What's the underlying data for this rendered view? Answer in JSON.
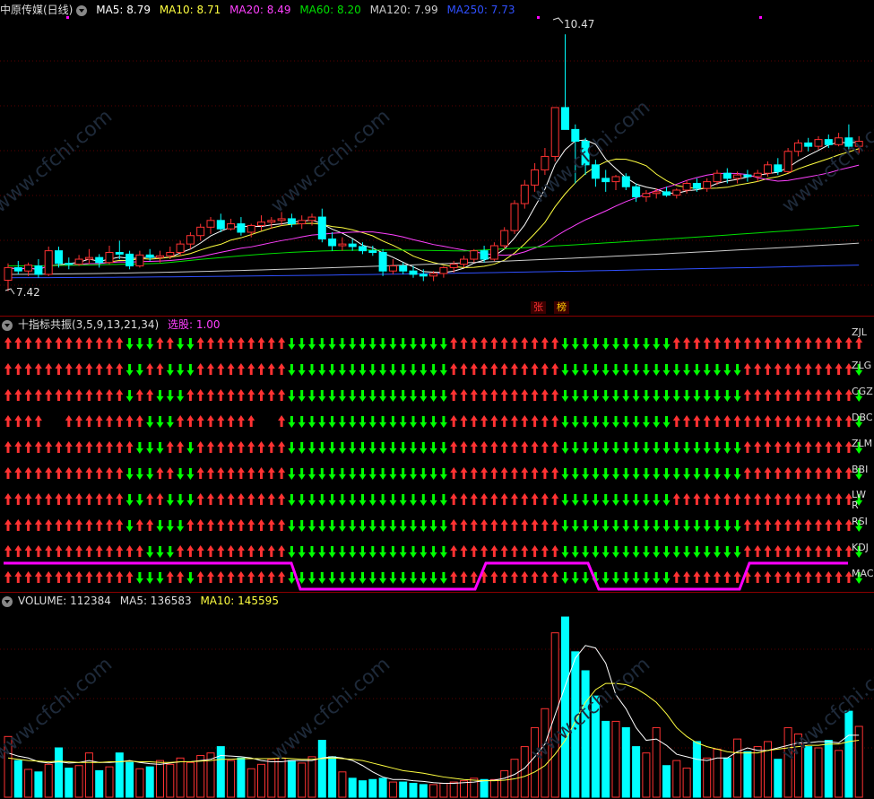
{
  "main": {
    "title": "中原传媒(日线)",
    "ma": [
      {
        "label": "MA5: 8.79",
        "color": "#ffffff"
      },
      {
        "label": "MA10: 8.71",
        "color": "#ffff40"
      },
      {
        "label": "MA20: 8.49",
        "color": "#ff40ff"
      },
      {
        "label": "MA60: 8.20",
        "color": "#00e000"
      },
      {
        "label": "MA120: 7.99",
        "color": "#cccccc"
      },
      {
        "label": "MA250: 7.73",
        "color": "#3050ff"
      }
    ],
    "high_label": "10.47",
    "low_label": "7.42",
    "tags": [
      "张",
      "榜"
    ]
  },
  "indicator": {
    "title": "十指标共振(3,5,9,13,21,34)",
    "pick_label": "选股: 1.00",
    "rows": [
      "ZJL",
      "ZLGJ",
      "CGZ",
      "DBC",
      "ZLMM",
      "BBI",
      "LWR",
      "RSI",
      "KDJ",
      "MACD"
    ],
    "row_labels": [
      "ZJL",
      "ZLG",
      "CGZ",
      "DBC",
      "ZLM",
      "BBI",
      "LW R",
      "RSI",
      "KDJ",
      "MAC"
    ]
  },
  "volume": {
    "title": "VOLUME: 112384",
    "ma5": "MA5: 136583",
    "ma10": "MA10: 145595"
  },
  "watermark": "www.cfchi.com",
  "colors": {
    "up": "#ff3232",
    "down": "#00ff00",
    "cyan": "#00ffff",
    "magenta": "#ff00ff",
    "grid": "#8b0000"
  },
  "chart_data": {
    "type": "candlestick",
    "title": "中原传媒(日线)",
    "price_extremes": {
      "high": 10.47,
      "low": 7.42
    },
    "candles": [
      {
        "o": 7.55,
        "h": 7.75,
        "l": 7.42,
        "c": 7.7
      },
      {
        "o": 7.7,
        "h": 7.78,
        "l": 7.62,
        "c": 7.66
      },
      {
        "o": 7.66,
        "h": 7.76,
        "l": 7.6,
        "c": 7.73
      },
      {
        "o": 7.72,
        "h": 7.8,
        "l": 7.58,
        "c": 7.62
      },
      {
        "o": 7.62,
        "h": 7.95,
        "l": 7.6,
        "c": 7.9
      },
      {
        "o": 7.9,
        "h": 7.95,
        "l": 7.7,
        "c": 7.75
      },
      {
        "o": 7.75,
        "h": 7.82,
        "l": 7.68,
        "c": 7.74
      },
      {
        "o": 7.74,
        "h": 7.85,
        "l": 7.72,
        "c": 7.8
      },
      {
        "o": 7.8,
        "h": 7.92,
        "l": 7.74,
        "c": 7.82
      },
      {
        "o": 7.82,
        "h": 7.86,
        "l": 7.7,
        "c": 7.76
      },
      {
        "o": 7.76,
        "h": 7.96,
        "l": 7.74,
        "c": 7.88
      },
      {
        "o": 7.88,
        "h": 8.02,
        "l": 7.8,
        "c": 7.86
      },
      {
        "o": 7.86,
        "h": 7.9,
        "l": 7.68,
        "c": 7.72
      },
      {
        "o": 7.72,
        "h": 7.9,
        "l": 7.7,
        "c": 7.85
      },
      {
        "o": 7.85,
        "h": 7.92,
        "l": 7.78,
        "c": 7.82
      },
      {
        "o": 7.82,
        "h": 7.9,
        "l": 7.76,
        "c": 7.84
      },
      {
        "o": 7.84,
        "h": 7.95,
        "l": 7.8,
        "c": 7.88
      },
      {
        "o": 7.88,
        "h": 8.02,
        "l": 7.84,
        "c": 7.98
      },
      {
        "o": 7.98,
        "h": 8.12,
        "l": 7.92,
        "c": 8.08
      },
      {
        "o": 8.08,
        "h": 8.22,
        "l": 8.02,
        "c": 8.18
      },
      {
        "o": 8.18,
        "h": 8.3,
        "l": 8.1,
        "c": 8.26
      },
      {
        "o": 8.26,
        "h": 8.34,
        "l": 8.12,
        "c": 8.16
      },
      {
        "o": 8.16,
        "h": 8.28,
        "l": 8.14,
        "c": 8.22
      },
      {
        "o": 8.22,
        "h": 8.3,
        "l": 8.08,
        "c": 8.12
      },
      {
        "o": 8.12,
        "h": 8.22,
        "l": 8.06,
        "c": 8.2
      },
      {
        "o": 8.2,
        "h": 8.32,
        "l": 8.14,
        "c": 8.24
      },
      {
        "o": 8.24,
        "h": 8.3,
        "l": 8.16,
        "c": 8.26
      },
      {
        "o": 8.26,
        "h": 8.36,
        "l": 8.2,
        "c": 8.28
      },
      {
        "o": 8.28,
        "h": 8.34,
        "l": 8.18,
        "c": 8.22
      },
      {
        "o": 8.22,
        "h": 8.32,
        "l": 8.16,
        "c": 8.26
      },
      {
        "o": 8.26,
        "h": 8.34,
        "l": 8.2,
        "c": 8.3
      },
      {
        "o": 8.3,
        "h": 8.4,
        "l": 8.0,
        "c": 8.04
      },
      {
        "o": 8.04,
        "h": 8.12,
        "l": 7.9,
        "c": 7.96
      },
      {
        "o": 7.96,
        "h": 8.06,
        "l": 7.9,
        "c": 7.98
      },
      {
        "o": 7.98,
        "h": 8.04,
        "l": 7.9,
        "c": 7.95
      },
      {
        "o": 7.95,
        "h": 8.0,
        "l": 7.86,
        "c": 7.9
      },
      {
        "o": 7.9,
        "h": 7.96,
        "l": 7.84,
        "c": 7.88
      },
      {
        "o": 7.88,
        "h": 7.92,
        "l": 7.6,
        "c": 7.66
      },
      {
        "o": 7.66,
        "h": 7.8,
        "l": 7.62,
        "c": 7.72
      },
      {
        "o": 7.72,
        "h": 7.76,
        "l": 7.62,
        "c": 7.66
      },
      {
        "o": 7.66,
        "h": 7.72,
        "l": 7.58,
        "c": 7.62
      },
      {
        "o": 7.62,
        "h": 7.68,
        "l": 7.54,
        "c": 7.6
      },
      {
        "o": 7.6,
        "h": 7.66,
        "l": 7.54,
        "c": 7.63
      },
      {
        "o": 7.63,
        "h": 7.72,
        "l": 7.58,
        "c": 7.7
      },
      {
        "o": 7.7,
        "h": 7.78,
        "l": 7.64,
        "c": 7.74
      },
      {
        "o": 7.74,
        "h": 7.84,
        "l": 7.7,
        "c": 7.8
      },
      {
        "o": 7.8,
        "h": 7.92,
        "l": 7.76,
        "c": 7.9
      },
      {
        "o": 7.9,
        "h": 7.96,
        "l": 7.76,
        "c": 7.8
      },
      {
        "o": 7.8,
        "h": 8.0,
        "l": 7.78,
        "c": 7.96
      },
      {
        "o": 7.96,
        "h": 8.18,
        "l": 7.92,
        "c": 8.14
      },
      {
        "o": 8.14,
        "h": 8.5,
        "l": 8.1,
        "c": 8.46
      },
      {
        "o": 8.46,
        "h": 8.74,
        "l": 8.4,
        "c": 8.68
      },
      {
        "o": 8.68,
        "h": 8.94,
        "l": 8.6,
        "c": 8.86
      },
      {
        "o": 8.86,
        "h": 9.12,
        "l": 8.8,
        "c": 9.02
      },
      {
        "o": 9.02,
        "h": 9.3,
        "l": 8.96,
        "c": 9.6
      },
      {
        "o": 9.6,
        "h": 10.47,
        "l": 9.5,
        "c": 9.34
      },
      {
        "o": 9.34,
        "h": 9.4,
        "l": 8.7,
        "c": 9.2
      },
      {
        "o": 9.2,
        "h": 9.24,
        "l": 8.8,
        "c": 8.92
      },
      {
        "o": 8.92,
        "h": 8.98,
        "l": 8.66,
        "c": 8.76
      },
      {
        "o": 8.76,
        "h": 8.86,
        "l": 8.6,
        "c": 8.72
      },
      {
        "o": 8.72,
        "h": 8.8,
        "l": 8.62,
        "c": 8.78
      },
      {
        "o": 8.78,
        "h": 8.82,
        "l": 8.62,
        "c": 8.66
      },
      {
        "o": 8.66,
        "h": 8.7,
        "l": 8.48,
        "c": 8.54
      },
      {
        "o": 8.54,
        "h": 8.62,
        "l": 8.48,
        "c": 8.58
      },
      {
        "o": 8.58,
        "h": 8.64,
        "l": 8.52,
        "c": 8.6
      },
      {
        "o": 8.6,
        "h": 8.66,
        "l": 8.54,
        "c": 8.56
      },
      {
        "o": 8.56,
        "h": 8.64,
        "l": 8.52,
        "c": 8.62
      },
      {
        "o": 8.62,
        "h": 8.74,
        "l": 8.58,
        "c": 8.7
      },
      {
        "o": 8.7,
        "h": 8.76,
        "l": 8.6,
        "c": 8.64
      },
      {
        "o": 8.64,
        "h": 8.76,
        "l": 8.6,
        "c": 8.72
      },
      {
        "o": 8.72,
        "h": 8.86,
        "l": 8.68,
        "c": 8.82
      },
      {
        "o": 8.82,
        "h": 8.88,
        "l": 8.7,
        "c": 8.76
      },
      {
        "o": 8.76,
        "h": 8.84,
        "l": 8.7,
        "c": 8.8
      },
      {
        "o": 8.8,
        "h": 8.86,
        "l": 8.72,
        "c": 8.78
      },
      {
        "o": 8.78,
        "h": 8.86,
        "l": 8.72,
        "c": 8.82
      },
      {
        "o": 8.82,
        "h": 8.96,
        "l": 8.78,
        "c": 8.92
      },
      {
        "o": 8.92,
        "h": 9.0,
        "l": 8.8,
        "c": 8.84
      },
      {
        "o": 8.84,
        "h": 9.12,
        "l": 8.82,
        "c": 9.08
      },
      {
        "o": 9.08,
        "h": 9.22,
        "l": 9.02,
        "c": 9.18
      },
      {
        "o": 9.18,
        "h": 9.24,
        "l": 9.08,
        "c": 9.14
      },
      {
        "o": 9.14,
        "h": 9.26,
        "l": 9.1,
        "c": 9.22
      },
      {
        "o": 9.22,
        "h": 9.28,
        "l": 9.12,
        "c": 9.16
      },
      {
        "o": 9.16,
        "h": 9.3,
        "l": 9.14,
        "c": 9.24
      },
      {
        "o": 9.24,
        "h": 9.4,
        "l": 9.1,
        "c": 9.14
      },
      {
        "o": 9.14,
        "h": 9.26,
        "l": 9.06,
        "c": 9.2
      }
    ],
    "volume": [
      96,
      58,
      44,
      40,
      52,
      78,
      46,
      50,
      70,
      42,
      48,
      70,
      55,
      45,
      48,
      58,
      52,
      62,
      55,
      66,
      70,
      80,
      58,
      62,
      45,
      52,
      60,
      62,
      58,
      54,
      64,
      90,
      64,
      40,
      30,
      26,
      28,
      30,
      24,
      24,
      22,
      20,
      20,
      22,
      24,
      26,
      30,
      28,
      28,
      42,
      60,
      80,
      110,
      140,
      260,
      285,
      230,
      200,
      160,
      120,
      120,
      110,
      80,
      70,
      110,
      50,
      58,
      46,
      88,
      62,
      76,
      62,
      92,
      72,
      80,
      88,
      60,
      110,
      100,
      80,
      78,
      90,
      74,
      136,
      112
    ],
    "vol_ma5": [
      70,
      65,
      62,
      56,
      54,
      56,
      54,
      55,
      58,
      55,
      55,
      56,
      58,
      55,
      53,
      52,
      54,
      56,
      56,
      58,
      60,
      66,
      65,
      64,
      62,
      58,
      56,
      56,
      58,
      58,
      58,
      62,
      64,
      62,
      58,
      50,
      40,
      32,
      28,
      28,
      26,
      25,
      23,
      22,
      22,
      23,
      24,
      26,
      27,
      30,
      36,
      46,
      64,
      84,
      130,
      176,
      220,
      240,
      236,
      212,
      162,
      140,
      110,
      90,
      92,
      82,
      68,
      64,
      60,
      58,
      62,
      62,
      72,
      78,
      74,
      74,
      78,
      82,
      86,
      86,
      88,
      88,
      86,
      98,
      98
    ],
    "vol_ma10": [
      62,
      60,
      58,
      57,
      56,
      57,
      56,
      55,
      55,
      55,
      56,
      56,
      57,
      56,
      56,
      55,
      55,
      56,
      56,
      57,
      58,
      60,
      60,
      61,
      61,
      61,
      61,
      62,
      61,
      60,
      60,
      61,
      62,
      61,
      60,
      58,
      54,
      50,
      46,
      42,
      40,
      38,
      35,
      32,
      30,
      28,
      27,
      26,
      26,
      27,
      29,
      33,
      40,
      50,
      68,
      90,
      120,
      150,
      170,
      180,
      180,
      178,
      172,
      162,
      150,
      132,
      110,
      96,
      86,
      80,
      76,
      72,
      70,
      70,
      70,
      74,
      76,
      78,
      80,
      82,
      82,
      84,
      84,
      88,
      90
    ]
  }
}
